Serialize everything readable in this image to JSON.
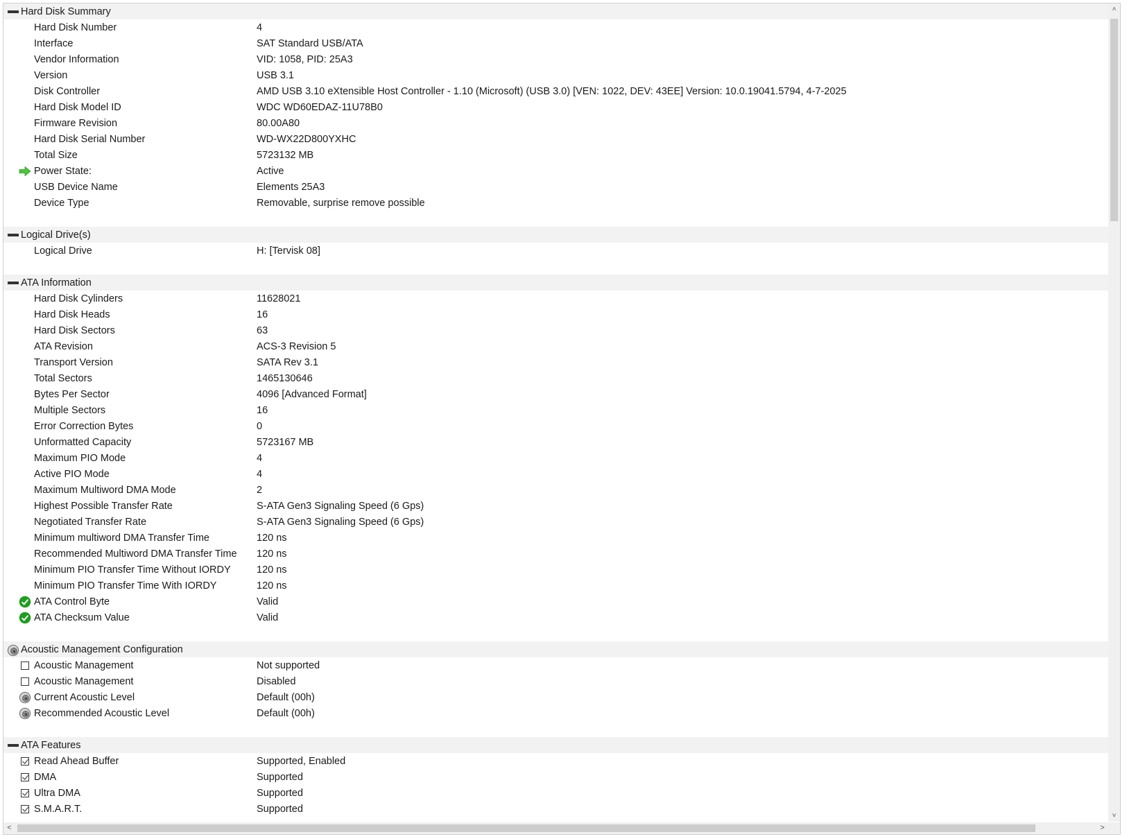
{
  "sections": [
    {
      "title": "Hard Disk Summary",
      "group_icon": "collapse-minus-icon",
      "rows": [
        {
          "label": "Hard Disk Number",
          "value": "4",
          "icon": null
        },
        {
          "label": "Interface",
          "value": "SAT Standard USB/ATA",
          "icon": null
        },
        {
          "label": "Vendor Information",
          "value": "VID: 1058, PID: 25A3",
          "icon": null
        },
        {
          "label": "Version",
          "value": "USB 3.1",
          "icon": null
        },
        {
          "label": "Disk Controller",
          "value": "AMD USB 3.10 eXtensible Host Controller - 1.10 (Microsoft) (USB 3.0) [VEN: 1022, DEV: 43EE] Version: 10.0.19041.5794, 4-7-2025",
          "icon": null
        },
        {
          "label": "Hard Disk Model ID",
          "value": "WDC WD60EDAZ-11U78B0",
          "icon": null
        },
        {
          "label": "Firmware Revision",
          "value": "80.00A80",
          "icon": null
        },
        {
          "label": "Hard Disk Serial Number",
          "value": "WD-WX22D800YXHC",
          "icon": null
        },
        {
          "label": "Total Size",
          "value": "5723132 MB",
          "icon": null
        },
        {
          "label": "Power State:",
          "value": "Active",
          "icon": "green-arrow-icon"
        },
        {
          "label": "USB Device Name",
          "value": "Elements 25A3",
          "icon": null
        },
        {
          "label": "Device Type",
          "value": "Removable, surprise remove possible",
          "icon": null
        }
      ]
    },
    {
      "title": "Logical Drive(s)",
      "group_icon": "collapse-minus-icon",
      "rows": [
        {
          "label": "Logical Drive",
          "value": "H: [Tervisk 08]",
          "icon": null
        }
      ]
    },
    {
      "title": "ATA Information",
      "group_icon": "collapse-minus-icon",
      "rows": [
        {
          "label": "Hard Disk Cylinders",
          "value": "11628021",
          "icon": null
        },
        {
          "label": "Hard Disk Heads",
          "value": "16",
          "icon": null
        },
        {
          "label": "Hard Disk Sectors",
          "value": "63",
          "icon": null
        },
        {
          "label": "ATA Revision",
          "value": "ACS-3 Revision 5",
          "icon": null
        },
        {
          "label": "Transport Version",
          "value": "SATA Rev 3.1",
          "icon": null
        },
        {
          "label": "Total Sectors",
          "value": "1465130646",
          "icon": null
        },
        {
          "label": "Bytes Per Sector",
          "value": "4096 [Advanced Format]",
          "icon": null
        },
        {
          "label": "Multiple Sectors",
          "value": "16",
          "icon": null
        },
        {
          "label": "Error Correction Bytes",
          "value": "0",
          "icon": null
        },
        {
          "label": "Unformatted Capacity",
          "value": "5723167 MB",
          "icon": null
        },
        {
          "label": "Maximum PIO Mode",
          "value": "4",
          "icon": null
        },
        {
          "label": "Active PIO Mode",
          "value": "4",
          "icon": null
        },
        {
          "label": "Maximum Multiword DMA Mode",
          "value": "2",
          "icon": null
        },
        {
          "label": "Highest Possible Transfer Rate",
          "value": "S-ATA Gen3 Signaling Speed (6 Gps)",
          "icon": null
        },
        {
          "label": "Negotiated Transfer Rate",
          "value": "S-ATA Gen3 Signaling Speed (6 Gps)",
          "icon": null
        },
        {
          "label": "Minimum multiword DMA Transfer Time",
          "value": "120 ns",
          "icon": null
        },
        {
          "label": "Recommended Multiword DMA Transfer Time",
          "value": "120 ns",
          "icon": null
        },
        {
          "label": "Minimum PIO Transfer Time Without IORDY",
          "value": "120 ns",
          "icon": null
        },
        {
          "label": "Minimum PIO Transfer Time With IORDY",
          "value": "120 ns",
          "icon": null
        },
        {
          "label": "ATA Control Byte",
          "value": "Valid",
          "icon": "green-check-icon"
        },
        {
          "label": "ATA Checksum Value",
          "value": "Valid",
          "icon": "green-check-icon"
        }
      ]
    },
    {
      "title": "Acoustic Management Configuration",
      "group_icon": "speaker-icon",
      "rows": [
        {
          "label": "Acoustic Management",
          "value": "Not supported",
          "icon": "checkbox-unchecked-icon"
        },
        {
          "label": "Acoustic Management",
          "value": "Disabled",
          "icon": "checkbox-unchecked-icon"
        },
        {
          "label": "Current Acoustic Level",
          "value": "Default (00h)",
          "icon": "speaker-icon"
        },
        {
          "label": "Recommended Acoustic Level",
          "value": "Default (00h)",
          "icon": "speaker-icon"
        }
      ]
    },
    {
      "title": "ATA Features",
      "group_icon": "collapse-minus-icon",
      "rows": [
        {
          "label": "Read Ahead Buffer",
          "value": "Supported, Enabled",
          "icon": "checkbox-checked-icon"
        },
        {
          "label": "DMA",
          "value": "Supported",
          "icon": "checkbox-checked-icon"
        },
        {
          "label": "Ultra DMA",
          "value": "Supported",
          "icon": "checkbox-checked-icon"
        },
        {
          "label": "S.M.A.R.T.",
          "value": "Supported",
          "icon": "checkbox-checked-icon"
        }
      ]
    }
  ],
  "colors": {
    "section_bg": "#f2f2f2",
    "green": "#1f9d1f",
    "arrow_green": "#4cc43c",
    "scrollbar_thumb": "#cdcdcd"
  },
  "scrollbars": {
    "up_glyph": "˄",
    "down_glyph": "˅",
    "left_glyph": "<",
    "right_glyph": ">"
  }
}
